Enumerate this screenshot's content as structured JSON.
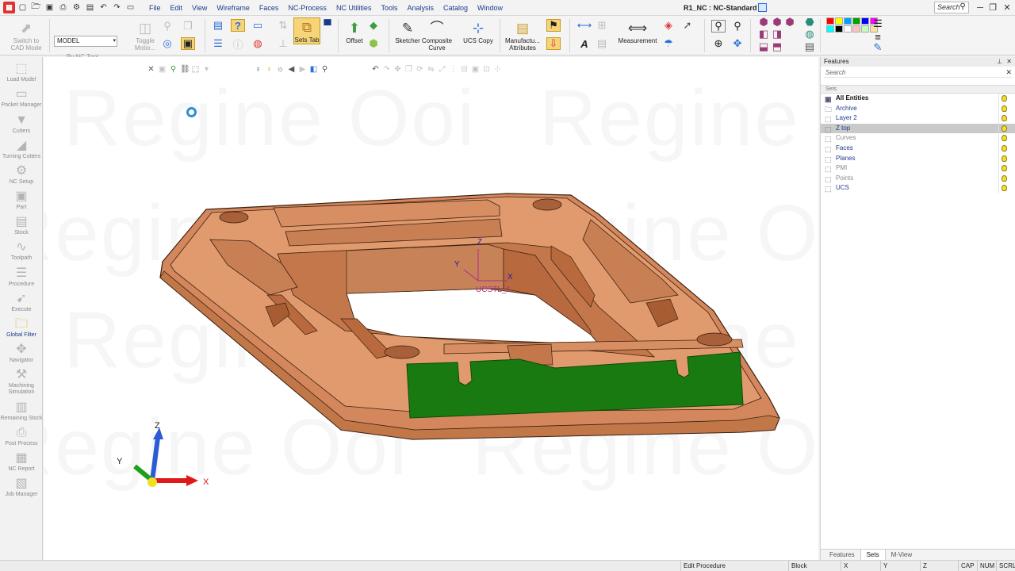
{
  "title_bar": {
    "document_title": "R1_NC : NC-Standard",
    "menu": [
      "File",
      "Edit",
      "View",
      "Wireframe",
      "Faces",
      "NC-Process",
      "NC Utilities",
      "Tools",
      "Analysis",
      "Catalog",
      "Window"
    ],
    "search_placeholder": "Search",
    "window_controls": [
      "─",
      "❐",
      "✕"
    ]
  },
  "ribbon": {
    "switch_cad": "Switch to CAD Mode",
    "model_value": "MODEL",
    "by_nc_tool": "By NC Tool",
    "toggle_motion": "Toggle Motio...",
    "sets_tab": "Sets Tab",
    "offset": "Offset",
    "sketcher": "Sketcher",
    "composite_curve": "Composite Curve",
    "ucs_copy": "UCS Copy",
    "manufacturing_attributes": "Manufactu... Attributes",
    "measurement": "Measurement",
    "palette_colors": [
      "#ff0000",
      "#ffff00",
      "#00a0ff",
      "#00a000",
      "#0000ff",
      "#ff00ff",
      "#00ffff",
      "#000000",
      "#ffffff",
      "#ffc0c0",
      "#c0ffc0",
      "#ffe0a0"
    ]
  },
  "sidebar": {
    "items": [
      {
        "label": "Load Model",
        "icon": "load-model-icon",
        "glyph": "⬚"
      },
      {
        "label": "Pocket Manager",
        "icon": "pocket-manager-icon",
        "glyph": "▭"
      },
      {
        "label": "Cutters",
        "icon": "cutters-icon",
        "glyph": "▼"
      },
      {
        "label": "Turning Cutters",
        "icon": "turning-cutters-icon",
        "glyph": "◢"
      },
      {
        "label": "NC Setup",
        "icon": "nc-setup-icon",
        "glyph": "⚙"
      },
      {
        "label": "Part",
        "icon": "part-icon",
        "glyph": "▣"
      },
      {
        "label": "Stock",
        "icon": "stock-icon",
        "glyph": "▤"
      },
      {
        "label": "Toolpath",
        "icon": "toolpath-icon",
        "glyph": "∿"
      },
      {
        "label": "Procedure",
        "icon": "procedure-icon",
        "glyph": "☰"
      },
      {
        "label": "Execute",
        "icon": "execute-icon",
        "glyph": "➹"
      },
      {
        "label": "Global Filter",
        "icon": "global-filter-icon",
        "glyph": "🗀"
      },
      {
        "label": "Navigator",
        "icon": "navigator-icon",
        "glyph": "✥"
      },
      {
        "label": "Machining Simulation",
        "icon": "machining-simulation-icon",
        "glyph": "⚒"
      },
      {
        "label": "Remaining Stock",
        "icon": "remaining-stock-icon",
        "glyph": "▥"
      },
      {
        "label": "Post Process",
        "icon": "post-process-icon",
        "glyph": "⎙"
      },
      {
        "label": "NC Report",
        "icon": "nc-report-icon",
        "glyph": "▦"
      },
      {
        "label": "Job Manager",
        "icon": "job-manager-icon",
        "glyph": "▧"
      }
    ],
    "active_index": 10
  },
  "viewport": {
    "watermark": "Regine Ooi",
    "ucs_label": "UCSTL_1",
    "axis_z": "Z",
    "axis_y": "Y",
    "axis_x": "X",
    "triad_z": "Z",
    "triad_y": "Y",
    "triad_x": "X",
    "part_color": "#d4875c",
    "highlight_color": "#1a7a12"
  },
  "features_panel": {
    "title": "Features",
    "search_placeholder": "Search",
    "column_header": "Sets",
    "rows": [
      {
        "label": "All Entities",
        "style": "bold"
      },
      {
        "label": "Archive",
        "style": "normal"
      },
      {
        "label": "Layer 2",
        "style": "normal"
      },
      {
        "label": "Z top",
        "style": "selected"
      },
      {
        "label": "Curves",
        "style": "muted"
      },
      {
        "label": "Faces",
        "style": "normal"
      },
      {
        "label": "Planes",
        "style": "normal"
      },
      {
        "label": "PMI",
        "style": "muted"
      },
      {
        "label": "Points",
        "style": "muted"
      },
      {
        "label": "UCS",
        "style": "normal"
      }
    ],
    "tabs": [
      "Features",
      "Sets",
      "M-View"
    ],
    "active_tab": 1
  },
  "status_bar": {
    "procedure": "Edit Procedure",
    "block": "Block",
    "x": "X",
    "y": "Y",
    "z": "Z",
    "cap": "CAP",
    "num": "NUM",
    "scrl": "SCRL"
  }
}
